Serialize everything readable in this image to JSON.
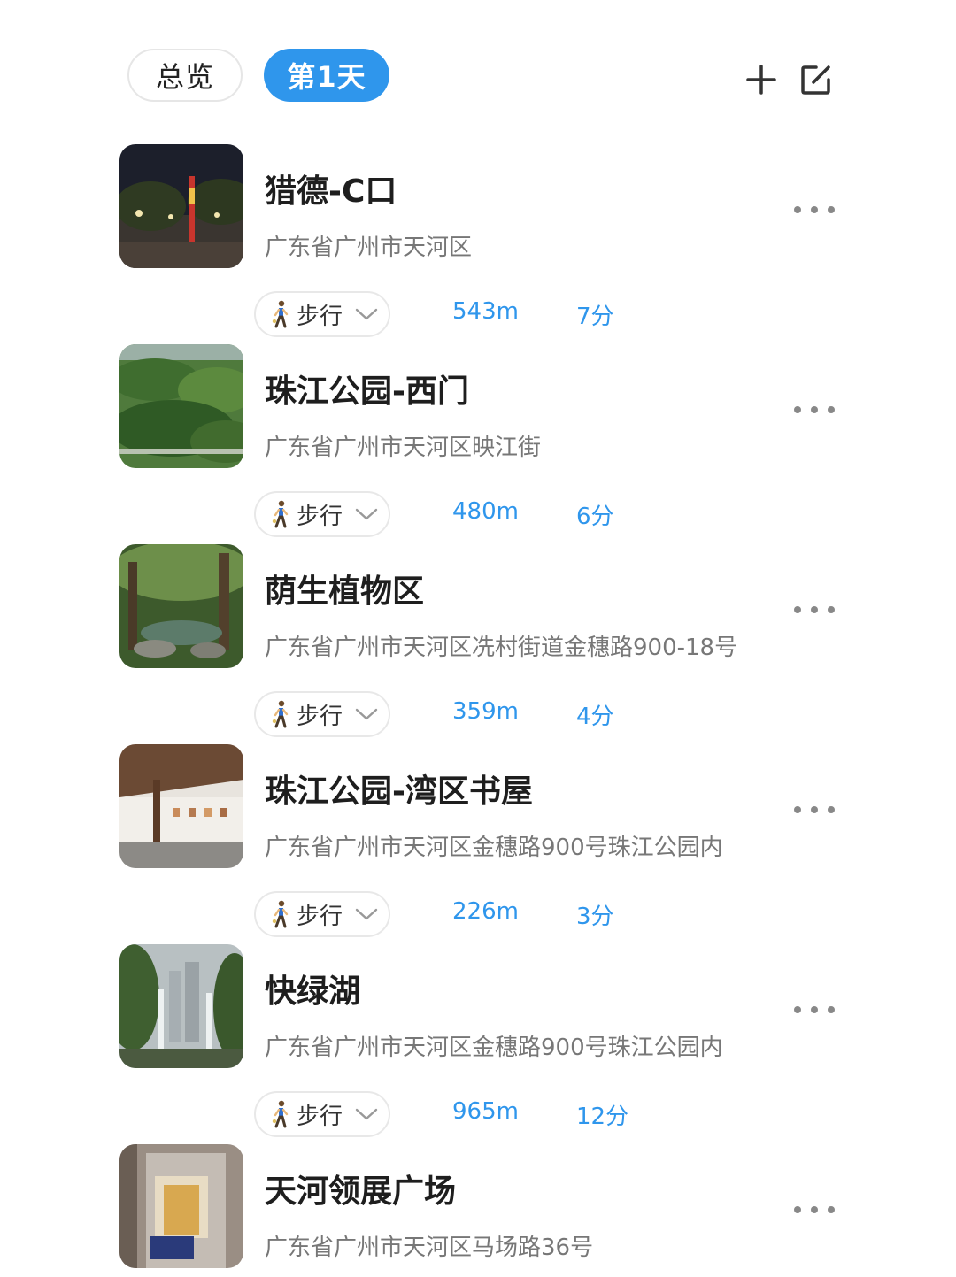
{
  "header": {
    "tabs": [
      {
        "label": "总览",
        "active": false
      },
      {
        "label": "第1天",
        "active": true
      }
    ],
    "accent_color": "#2f96ec",
    "actions": [
      {
        "icon": "plus-icon"
      },
      {
        "icon": "edit-icon"
      }
    ]
  },
  "stops": [
    {
      "name": "猎德-C口",
      "address": "广东省广州市天河区",
      "photo": "night-plaza",
      "travel": {
        "mode": "步行",
        "distance": "543m",
        "duration": "7分"
      }
    },
    {
      "name": "珠江公园-西门",
      "address": "广东省广州市天河区映江街",
      "photo": "green-park",
      "travel": {
        "mode": "步行",
        "distance": "480m",
        "duration": "6分"
      }
    },
    {
      "name": "荫生植物区",
      "address": "广东省广州市天河区冼村街道金穗路900-18号",
      "photo": "garden",
      "travel": {
        "mode": "步行",
        "distance": "359m",
        "duration": "4分"
      }
    },
    {
      "name": "珠江公园-湾区书屋",
      "address": "广东省广州市天河区金穗路900号珠江公园内",
      "photo": "gallery",
      "travel": {
        "mode": "步行",
        "distance": "226m",
        "duration": "3分"
      }
    },
    {
      "name": "快绿湖",
      "address": "广东省广州市天河区金穗路900号珠江公园内",
      "photo": "fountain",
      "travel": {
        "mode": "步行",
        "distance": "965m",
        "duration": "12分"
      }
    },
    {
      "name": "天河领展广场",
      "address": "广东省广州市天河区马场路36号",
      "photo": "mall"
    }
  ]
}
